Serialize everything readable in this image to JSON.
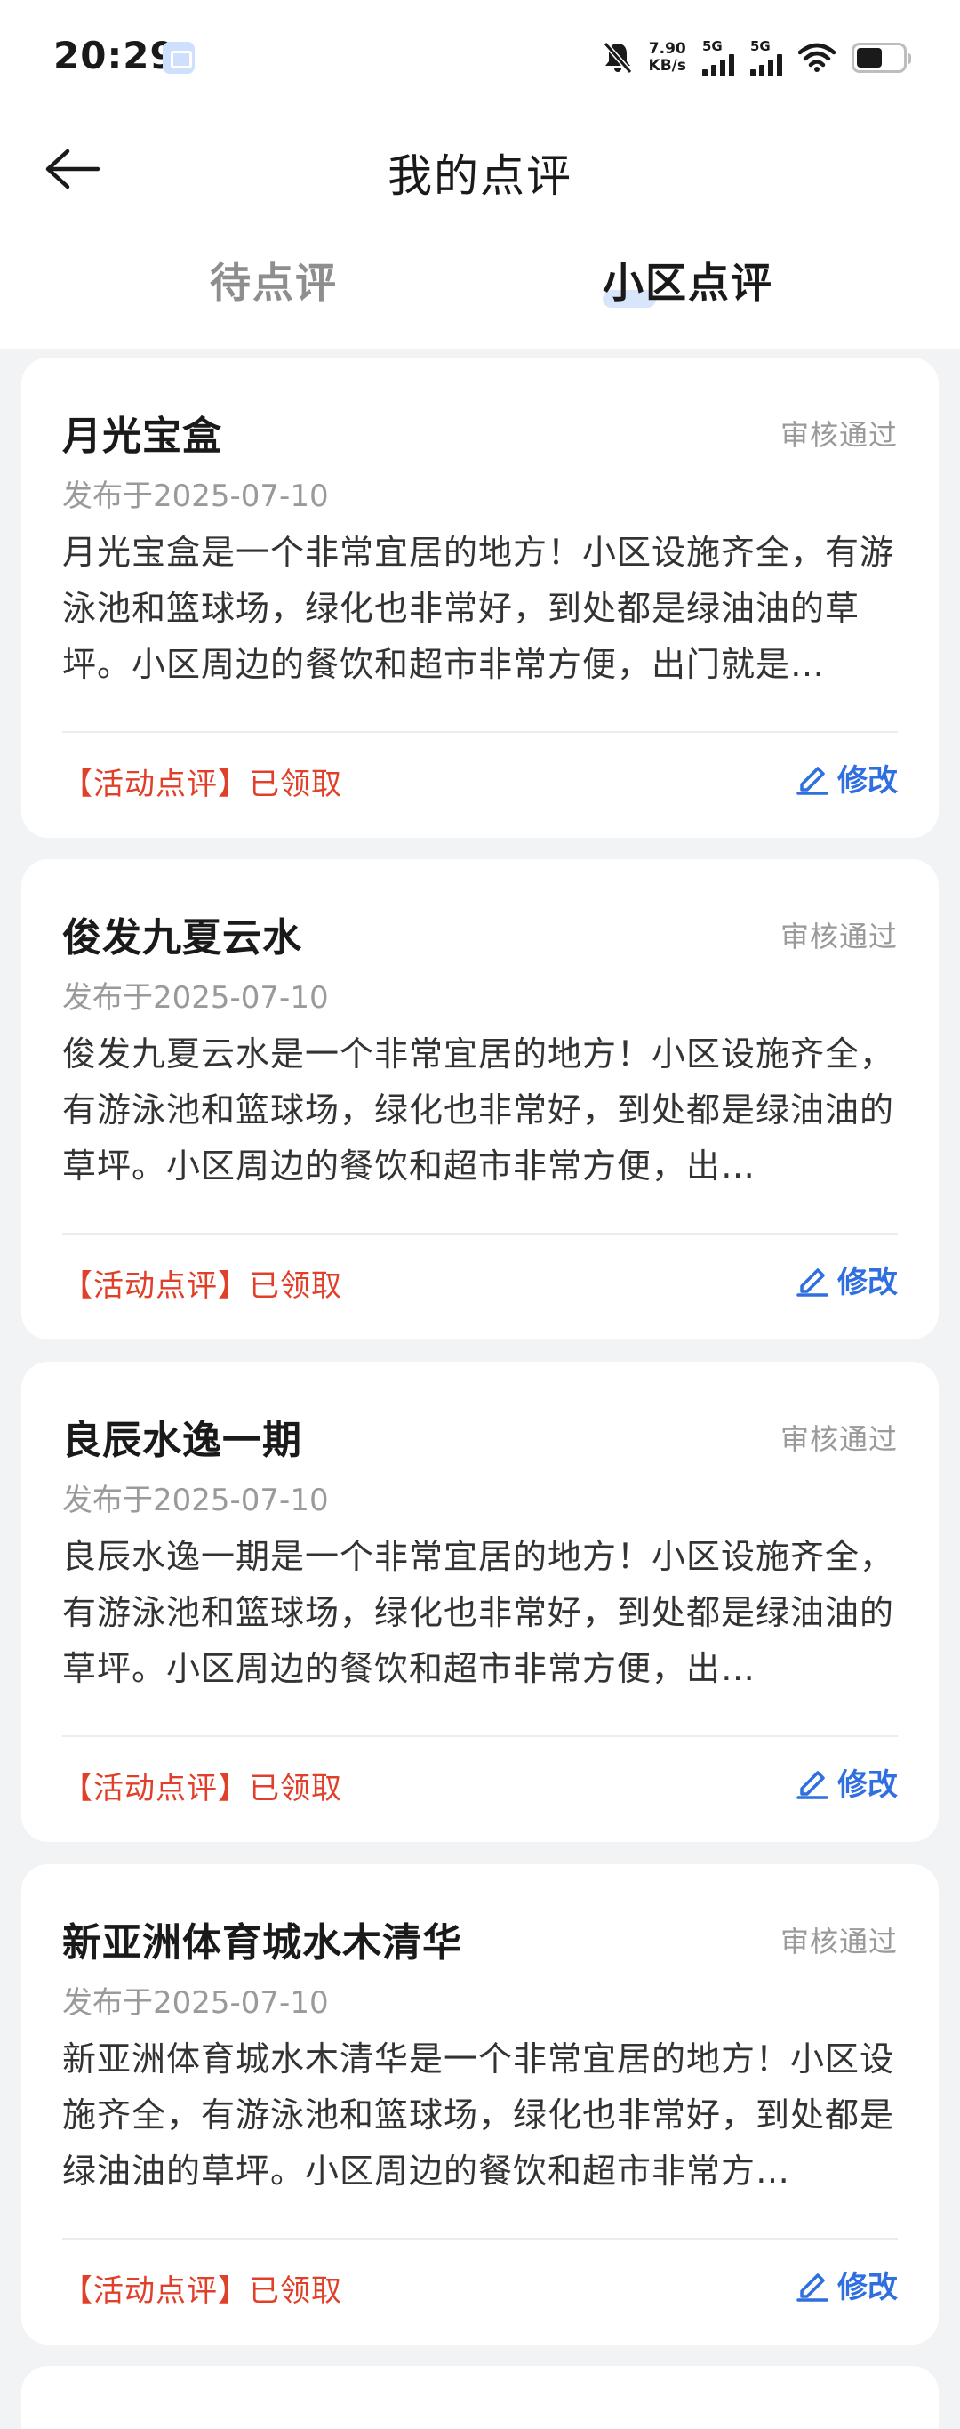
{
  "status_bar": {
    "time": "20:29",
    "net_speed_value": "7.90",
    "net_speed_unit": "KB/s",
    "signal1_tag": "5G",
    "signal2_tag": "5G",
    "battery_percent": 55
  },
  "header": {
    "title": "我的点评"
  },
  "tabs": [
    {
      "label": "待点评",
      "active": false
    },
    {
      "label": "小区点评",
      "active": true
    }
  ],
  "reviews": [
    {
      "title": "月光宝盒",
      "status": "审核通过",
      "date": "发布于2025-07-10",
      "body": "月光宝盒是一个非常宜居的地方！小区设施齐全，有游泳池和篮球场，绿化也非常好，到处都是绿油油的草坪。小区周边的餐饮和超市非常方便，出门就是…",
      "tag": "【活动点评】已领取",
      "edit_label": "修改"
    },
    {
      "title": "俊发九夏云水",
      "status": "审核通过",
      "date": "发布于2025-07-10",
      "body": "俊发九夏云水是一个非常宜居的地方！小区设施齐全，有游泳池和篮球场，绿化也非常好，到处都是绿油油的草坪。小区周边的餐饮和超市非常方便，出…",
      "tag": "【活动点评】已领取",
      "edit_label": "修改"
    },
    {
      "title": "良辰水逸一期",
      "status": "审核通过",
      "date": "发布于2025-07-10",
      "body": "良辰水逸一期是一个非常宜居的地方！小区设施齐全，有游泳池和篮球场，绿化也非常好，到处都是绿油油的草坪。小区周边的餐饮和超市非常方便，出…",
      "tag": "【活动点评】已领取",
      "edit_label": "修改"
    },
    {
      "title": "新亚洲体育城水木清华",
      "status": "审核通过",
      "date": "发布于2025-07-10",
      "body": "新亚洲体育城水木清华是一个非常宜居的地方！小区设施齐全，有游泳池和篮球场，绿化也非常好，到处都是绿油油的草坪。小区周边的餐饮和超市非常方…",
      "tag": "【活动点评】已领取",
      "edit_label": "修改"
    }
  ],
  "icons": {
    "back": "arrow-left-icon",
    "edit": "pencil-icon",
    "mute": "bell-off-icon",
    "wifi": "wifi-icon",
    "battery": "battery-icon"
  },
  "colors": {
    "accent": "#2f6fe0",
    "tag_red": "#e0402a",
    "muted": "#9a9a9a"
  }
}
